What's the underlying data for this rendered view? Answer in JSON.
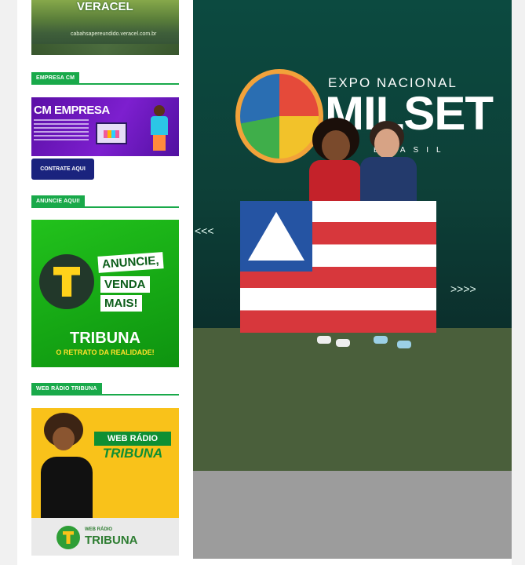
{
  "sidebar": {
    "veracel": {
      "logo": "VERACEL",
      "sub": "cabahsapereundido.veracel.com.br"
    },
    "empresa_title": "Empresa CM",
    "cm_banner": {
      "title": "CM EMPRESA"
    },
    "contrate_label": "CONTRATE AQUI",
    "anuncie_title": "Anuncie Aqui!",
    "anuncie_banner": {
      "line1": "ANUNCIE,",
      "line2": "VENDA",
      "line3": "MAIS!",
      "brand": "TRIBUNA",
      "slogan": "O RETRATO DA REALIDADE!"
    },
    "radio_title": "Web Rádio Tribuna",
    "radio_banner": {
      "tag": "WEB RÁDIO",
      "name": "TRIBUNA",
      "logo_small": "WEB RÁDIO",
      "logo_big": "TRIBUNA"
    }
  },
  "photo": {
    "expo_small": "EXPO NACIONAL",
    "expo_big": "MILSET",
    "expo_sub": "BRASIL",
    "arrows_left": "<<<",
    "arrows_right": ">>>>"
  },
  "colors": {
    "green": "#19a94a",
    "navy": "#1a237e",
    "purple": "#6a16bb",
    "yellow": "#f9c21a"
  }
}
